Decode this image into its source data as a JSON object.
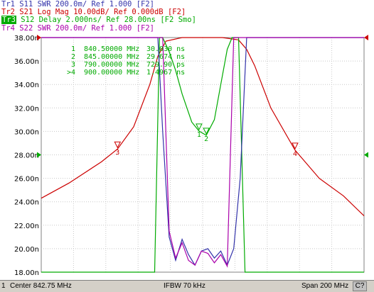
{
  "traces": [
    {
      "label": "Tr1",
      "param": "S11",
      "format": "SWR",
      "scale": "200.0m/",
      "ref": "Ref 1.000",
      "ch": "[F2]",
      "color": "#3333aa"
    },
    {
      "label": "Tr2",
      "param": "S21",
      "format": "Log Mag",
      "scale": "10.00dB/",
      "ref": "Ref 0.000dB",
      "ch": "[F2]",
      "color": "#cc0000"
    },
    {
      "label": "Tr3",
      "param": "S12",
      "format": "Delay",
      "scale": "2.000ns/",
      "ref": "Ref 28.00ns",
      "ch": "[F2 Smo]",
      "color": "#00aa00"
    },
    {
      "label": "Tr4",
      "param": "S22",
      "format": "SWR",
      "scale": "200.0m/",
      "ref": "Ref 1.000",
      "ch": "[F2]",
      "color": "#aa00aa"
    }
  ],
  "y_axis": {
    "ticks": [
      "38.00n",
      "36.00n",
      "34.00n",
      "32.00n",
      "30.00n",
      "28.00n",
      "26.00n",
      "24.00n",
      "22.00n",
      "20.00n",
      "18.00n"
    ]
  },
  "marker_table": [
    {
      "num": "1",
      "freq": "840.50000 MHz",
      "value": "30.030 ns"
    },
    {
      "num": "2",
      "freq": "845.00000 MHz",
      "value": "29.674 ns"
    },
    {
      "num": "3",
      "freq": "790.00000 MHz",
      "value": "729.90 ps"
    },
    {
      "num": ">4",
      "freq": "900.00000 MHz",
      "value": "1.4967 ns"
    }
  ],
  "status": {
    "channel": "1",
    "center": "Center 842.75 MHz",
    "ifbw": "IFBW 70 kHz",
    "span": "Span 200 MHz",
    "correction": "C?"
  },
  "chart_data": {
    "type": "line",
    "x_range_mhz": [
      742.75,
      942.75
    ],
    "ylim": [
      18.0,
      38.0
    ],
    "y_unit": "ns (Tr3 delay scale)",
    "series": [
      {
        "name": "Tr1 S11 SWR",
        "x": [
          742.75,
          815,
          818,
          822,
          826,
          830,
          834,
          838,
          842,
          846,
          850,
          854,
          858,
          862,
          866,
          870,
          942.75
        ],
        "y": [
          38.0,
          38.0,
          30.0,
          21.0,
          19.0,
          20.8,
          19.5,
          18.6,
          19.8,
          20.0,
          19.2,
          19.8,
          18.6,
          20.0,
          26.0,
          38.0,
          38.0
        ]
      },
      {
        "name": "Tr2 S21 Log Mag",
        "x": [
          742.75,
          760,
          780,
          790,
          800,
          810,
          815,
          820,
          830,
          842,
          855,
          865,
          870,
          875,
          885,
          900,
          915,
          930,
          942.75
        ],
        "y": [
          24.3,
          25.6,
          27.4,
          28.5,
          30.4,
          34.0,
          36.4,
          37.7,
          38.0,
          38.0,
          38.0,
          37.8,
          37.0,
          35.6,
          32.0,
          28.4,
          26.0,
          24.5,
          22.8
        ]
      },
      {
        "name": "Tr3 S12 Delay",
        "x": [
          742.75,
          813,
          816,
          818,
          822,
          826,
          830,
          836,
          840.5,
          845,
          850,
          854,
          858,
          861,
          865,
          869,
          942.75
        ],
        "y": [
          18.0,
          18.0,
          38.0,
          38.0,
          36.8,
          35.2,
          33.2,
          30.8,
          30.03,
          29.67,
          31.0,
          34.0,
          37.0,
          38.0,
          38.0,
          18.0,
          18.0
        ]
      },
      {
        "name": "Tr4 S22 SWR",
        "x": [
          742.75,
          818,
          822,
          826,
          830,
          834,
          838,
          842,
          846,
          850,
          854,
          858,
          862,
          942.75
        ],
        "y": [
          38.0,
          38.0,
          21.5,
          19.2,
          20.5,
          19.0,
          18.6,
          19.8,
          19.6,
          18.8,
          19.5,
          18.5,
          38.0,
          38.0
        ]
      }
    ]
  }
}
